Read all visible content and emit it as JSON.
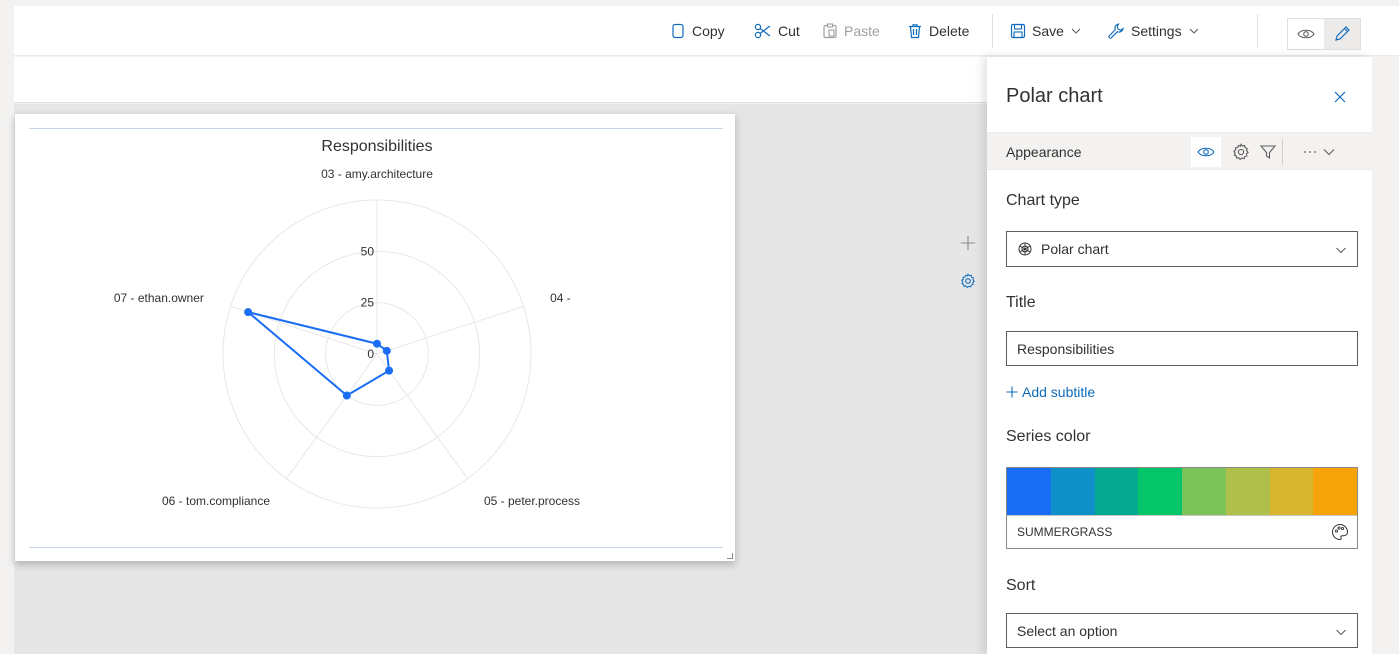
{
  "toolbar": {
    "copy_label": "Copy",
    "cut_label": "Cut",
    "paste_label": "Paste",
    "delete_label": "Delete",
    "save_label": "Save",
    "settings_label": "Settings",
    "icons": [
      "copy-icon",
      "scissors-icon",
      "paste-icon",
      "trash-icon",
      "save-icon",
      "wrench-icon",
      "eye-icon",
      "pencil-icon"
    ]
  },
  "chart_data": {
    "type": "polar",
    "title": "Responsibilities",
    "categories": [
      "03 - amy.architecture",
      "04 -",
      "05 - peter.process",
      "06 - tom.compliance",
      "07 - ethan.owner"
    ],
    "values": [
      5,
      5,
      10,
      25,
      66
    ],
    "radial_ticks": [
      0,
      25,
      50
    ],
    "ylim": [
      0,
      75
    ],
    "series_color": "#1a6ef5",
    "grid": true
  },
  "panel": {
    "title": "Polar chart",
    "tab_label": "Appearance",
    "chart_type_label": "Chart type",
    "chart_type_value": "Polar chart",
    "title_label": "Title",
    "title_value": "Responsibilities",
    "add_subtitle_label": "Add subtitle",
    "series_color_label": "Series color",
    "palette_name": "SUMMERGRASS",
    "palette_colors": [
      "#1a6ef5",
      "#0f90c8",
      "#05a98f",
      "#05c56b",
      "#7cc45a",
      "#aebf4c",
      "#d8b52f",
      "#f7a30a"
    ],
    "sort_label": "Sort",
    "sort_placeholder": "Select an option"
  },
  "colors": {
    "accent": "#0f6cbd",
    "series": "#1a6ef5"
  }
}
